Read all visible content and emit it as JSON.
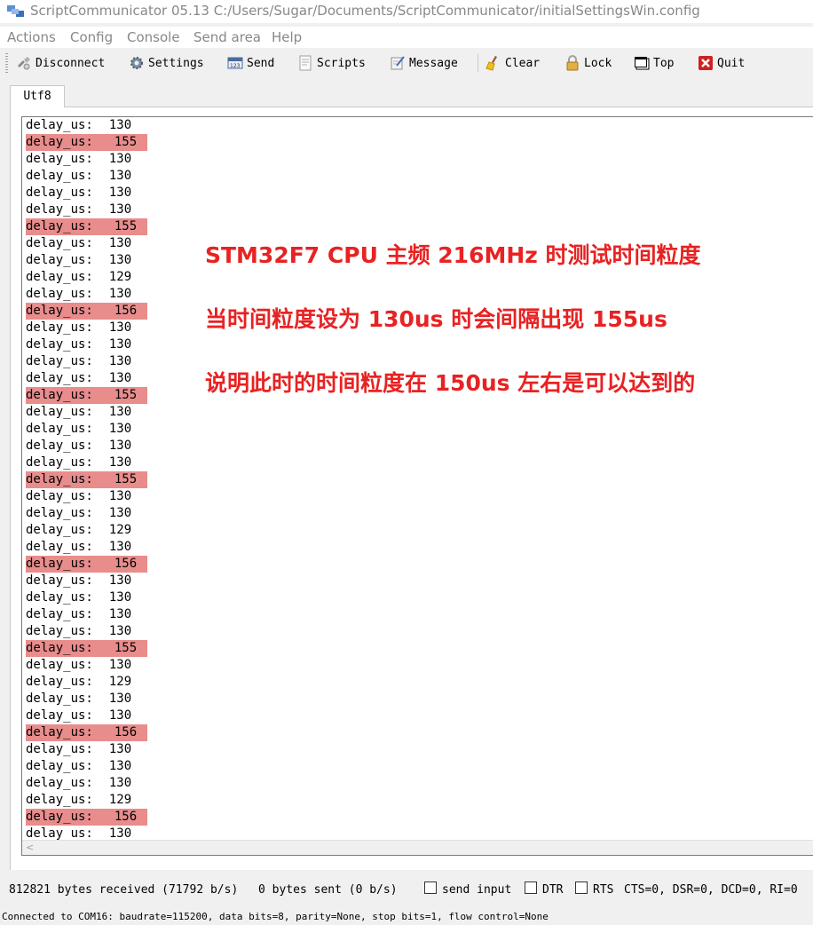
{
  "window": {
    "title": "ScriptCommunicator 05.13   C:/Users/Sugar/Documents/ScriptCommunicator/initialSettingsWin.config"
  },
  "menu": [
    "Actions",
    "Config",
    "Console",
    "Send area",
    "Help"
  ],
  "toolbar": {
    "disconnect": "Disconnect",
    "settings": "Settings",
    "send": "Send",
    "scripts": "Scripts",
    "message": "Message",
    "clear": "Clear",
    "lock": "Lock",
    "top": "Top",
    "quit": "Quit"
  },
  "tab": {
    "label": "Utf8"
  },
  "log": {
    "label": "delay_us:",
    "values": [
      "130",
      "155",
      "130",
      "130",
      "130",
      "130",
      "155",
      "130",
      "130",
      "129",
      "130",
      "156",
      "130",
      "130",
      "130",
      "130",
      "155",
      "130",
      "130",
      "130",
      "130",
      "155",
      "130",
      "130",
      "129",
      "130",
      "156",
      "130",
      "130",
      "130",
      "130",
      "155",
      "130",
      "129",
      "130",
      "130",
      "156",
      "130",
      "130",
      "130",
      "129",
      "156",
      "130"
    ],
    "highlight_color": "#e88c8c"
  },
  "annotations": [
    "STM32F7 CPU 主频 216MHz 时测试时间粒度",
    "当时间粒度设为 130us 时会间隔出现 155us",
    "说明此时的时间粒度在 150us 左右是可以达到的"
  ],
  "status": {
    "received": "812821 bytes received (71792 b/s)",
    "sent": "0 bytes sent (0 b/s)",
    "send_input": "send input",
    "dtr": "DTR",
    "rts": "RTS",
    "signals": "CTS=0, DSR=0, DCD=0, RI=0"
  },
  "connection": "Connected to COM16: baudrate=115200, data bits=8, parity=None, stop bits=1, flow control=None",
  "colors": {
    "annotation": "#e82222",
    "highlight": "#e88c8c"
  }
}
